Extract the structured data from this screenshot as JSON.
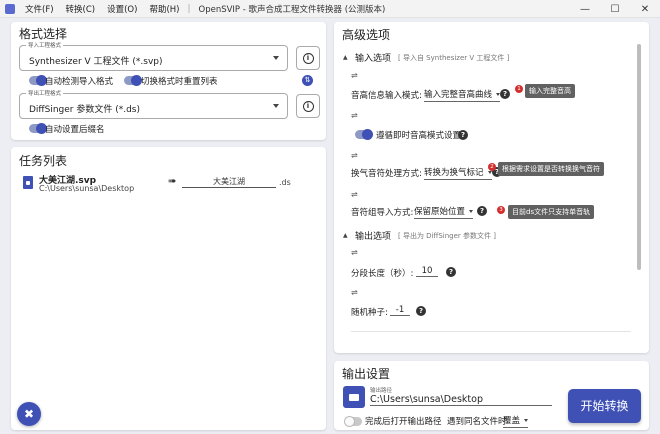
{
  "titlebar": {
    "menus": [
      "文件(F)",
      "转换(C)",
      "设置(O)",
      "帮助(H)"
    ],
    "separator": "|",
    "title": "OpenSVIP - 歌声合成工程文件转换器 (公测版本)",
    "controls": {
      "minimize": "—",
      "maximize": "☐",
      "close": "✕"
    }
  },
  "format": {
    "title": "格式选择",
    "import_legend": "导入工程格式",
    "import_value": "Synthesizer V 工程文件 (*.svp)",
    "auto_detect_label": "自动检测导入格式",
    "reset_on_switch_label": "切换格式时重置列表",
    "export_legend": "导出工程格式",
    "export_value": "DiffSinger 参数文件 (*.ds)",
    "auto_ext_label": "自动设置后缀名",
    "info_glyph": "i",
    "swap_glyph": "⇅"
  },
  "tasks": {
    "title": "任务列表",
    "items": [
      {
        "name": "大美江湖.svp",
        "path": "C:\\Users\\sunsa\\Desktop",
        "arrow": "➠",
        "output_name": "大美江湖",
        "ext": ".ds"
      }
    ],
    "fab_glyph": "✖"
  },
  "advanced": {
    "title": "高级选项",
    "import_section": {
      "title": "输入选项",
      "hint": "[ 导入自 Synthesizer V 工程文件 ]"
    },
    "pitch_mode": {
      "label": "音高信息输入模式:",
      "value": "输入完整音高曲线",
      "tip_num": "1",
      "tip": "输入完整音高"
    },
    "breath_toggle_label": "遵循即时音高模式设置",
    "breath": {
      "label": "换气音符处理方式:",
      "value": "转换为换气标记",
      "tip_num": "2",
      "tip": "根据需求设置是否转换换气音符"
    },
    "group": {
      "label": "音符组导入方式:",
      "value": "保留原始位置",
      "tip_num": "3",
      "tip": "目前ds文件只支持单音轨"
    },
    "export_section": {
      "title": "输出选项",
      "hint": "[ 导出为 DiffSinger 参数文件 ]"
    },
    "segment": {
      "label": "分段长度（秒）:",
      "value": "10"
    },
    "seed": {
      "label": "随机种子:",
      "value": "-1"
    },
    "option_icon": "⇌",
    "help_glyph": "?",
    "collapse_glyph": "▲"
  },
  "output": {
    "title": "输出设置",
    "path_legend": "输出路径",
    "path_value": "C:\\Users\\sunsa\\Desktop",
    "open_after_label": "完成后打开输出路径",
    "conflict_label": "遇到同名文件时",
    "conflict_value": "覆盖",
    "convert_label": "开始转换"
  },
  "colors": {
    "accent": "#3f51b5",
    "tip": "#d32f2f",
    "tooltip": "#616161"
  }
}
